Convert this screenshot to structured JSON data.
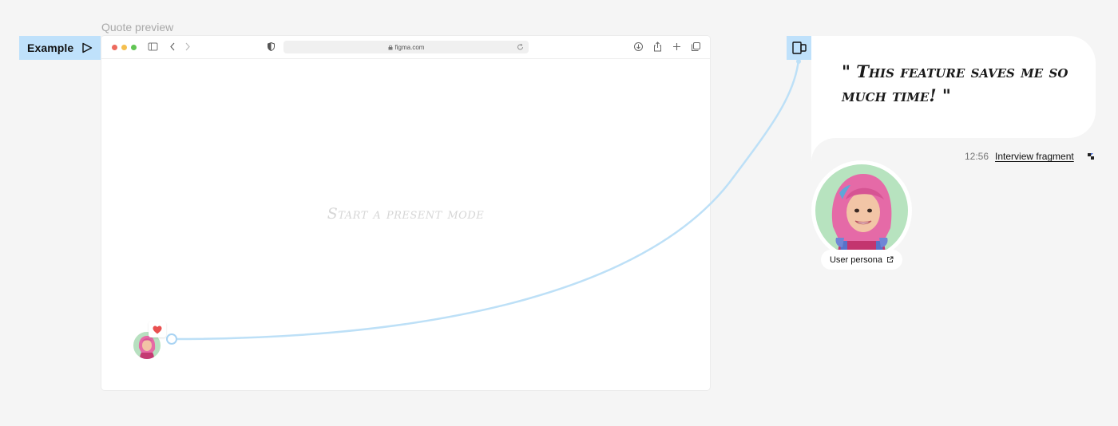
{
  "frame": {
    "title": "Quote preview"
  },
  "example_tag": {
    "label": "Example",
    "icon": "play-icon"
  },
  "browser": {
    "url": "figma.com",
    "traffic_lights": [
      "#ed6a5e",
      "#f5bf4f",
      "#61c554"
    ],
    "placeholder": "Start a present mode"
  },
  "quote": {
    "text": "\" This feature saves me so much time! \"",
    "time": "12:56",
    "source_label": "Interview fragment"
  },
  "persona": {
    "label": "User persona"
  },
  "colors": {
    "accent": "#bfe1fb",
    "connector": "#bde0f7",
    "canvas": "#f5f5f5",
    "avatar_bg": "#b7e3bf",
    "heart": "#e95050"
  }
}
